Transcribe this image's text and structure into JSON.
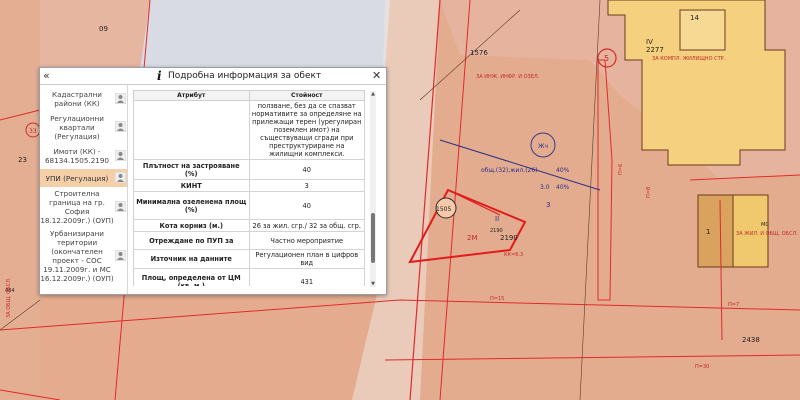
{
  "panel": {
    "title": "Подробна информация за обект",
    "collapse_icon": "«",
    "info_icon": "i",
    "close_icon": "✕",
    "nav_items": [
      {
        "label": "Кадастрални райони (КК)",
        "active": false
      },
      {
        "label": "Регулационни квартали (Регулация)",
        "active": false
      },
      {
        "label": "Имоти (КК) - 68134.1505.2190",
        "active": false
      },
      {
        "label": "УПИ (Регулация)",
        "active": true
      },
      {
        "label": "Строителна граница на гр. София 18.12.2009г.) (ОУП)",
        "active": false
      },
      {
        "label": "Урбанизирани територии (окончателен проект - СОС 19.11.2009г. и МС 16.12.2009г.) (ОУП)",
        "active": false
      }
    ],
    "table": {
      "headers": [
        "Атрибут",
        "Стойност"
      ],
      "rows": [
        {
          "key": "",
          "value": "ползване, без да се спазват нормативите за определяне на прилежащи терен (урегулиран поземлен имот) на съществуващи сгради при преструктуриране на жилищни комплекси."
        },
        {
          "key": "Плътност на застрояване (%)",
          "value": "40"
        },
        {
          "key": "КИНТ",
          "value": "3"
        },
        {
          "key": "Минимална озеленена площ (%)",
          "value": "40"
        },
        {
          "key": "Кота корниз (м.)",
          "value": "26 за жил. сгр./ 32 за общ. сгр."
        },
        {
          "key": "Отреждане по ПУП за",
          "value": "Частно мероприятие"
        },
        {
          "key": "Източник на данните",
          "value": "Регулационен план в цифров вид"
        },
        {
          "key": "Площ, определена от ЦМ (кв. м.)",
          "value": "431"
        }
      ]
    }
  },
  "map": {
    "labels": {
      "n1576": "1576",
      "n14": "14",
      "n5": "5",
      "iv": "IV",
      "n2277": "2277",
      "n33": "33",
      "n09": "09",
      "n23": "23",
      "n1505": "1505",
      "n2190": "2190",
      "n2m": "2М",
      "nII": "II",
      "n2438": "2438",
      "n484": "484",
      "n1": "1",
      "n3": "3",
      "n7": "7",
      "zh4": "Жч",
      "p15": "П=15",
      "p30": "П=30",
      "p7": "П=7",
      "p6": "П=6",
      "p8": "П=8",
      "pct40a": "40%",
      "val30": "3.0",
      "pct40b": "40%",
      "kk": "КК=6.3",
      "za_inzh": "ЗА ИНЖ. ИНФР. И ОЗЕЛ.",
      "za_kompl": "ЗА КОМПЛ. ЖИЛИЩНО СТР.",
      "obsht": "общ.(32),жил.(26)",
      "za_obsht_left": "ЗА ОБЩ. ОБСЛ.",
      "za_obsht_right": "ЗА ЖИЛ. И ОБЩ. ОБСЛ.",
      "mc": "МС"
    }
  }
}
